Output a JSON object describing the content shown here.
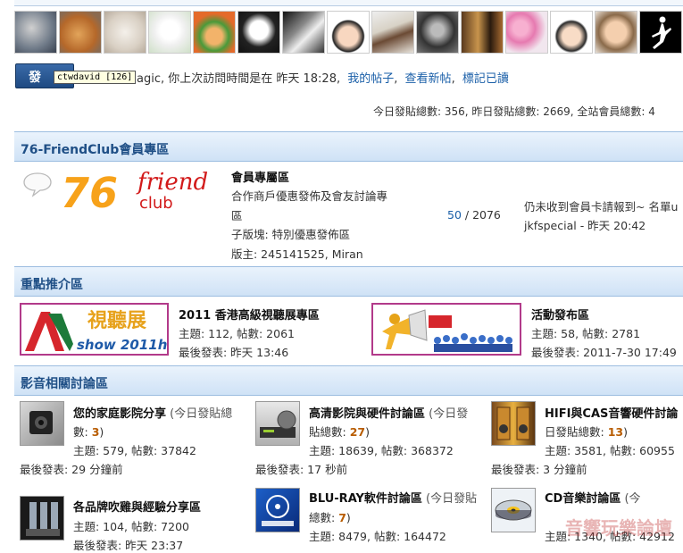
{
  "post_button": {
    "label": "發"
  },
  "tooltip": {
    "text": "ctwdavid [126]"
  },
  "welcome": {
    "text": "agic, 你上次訪問時間是在 昨天 18:28,",
    "my_posts": "我的帖子",
    "view_new": "查看新帖",
    "mark_read": "標記已讀"
  },
  "stats": {
    "text": "今日發貼總數: 356, 昨日發貼總數: 2669, 全站會員總數: 4"
  },
  "avatars": [
    "ultraman-avatar",
    "apple-avatar",
    "white-cat-avatar",
    "cartoon-head-avatar",
    "green-hair-avatar",
    "skull-avatar",
    "bw-photo-avatar",
    "cartoon-face-avatar",
    "horse-rider-avatar",
    "bw-portrait-avatar",
    "room-avatar",
    "pink-hat-girls-avatar",
    "cartoon-girl-avatar",
    "baby-avatar",
    "jumpman-avatar"
  ],
  "sections": {
    "friendclub": {
      "title": "76-FriendClub會員專區",
      "logo": {
        "num": "76",
        "word1": "friend",
        "word2": "club"
      },
      "forum": {
        "name": "會員專屬區",
        "desc1": "合作商戶優惠發佈及會友討論專",
        "desc2": "區",
        "sub": "子版塊: 特別優惠發佈區",
        "mods": "版主: 245141525, Miran",
        "counts_a": "50",
        "counts_b": " / 2076",
        "last_title": "仍未收到會員卡請報到~ 名單u",
        "last_by": "jkfspecial - 昨天 20:42"
      }
    },
    "featured": {
      "title": "重點推介區",
      "items": [
        {
          "name": "2011 香港高級視聽展專區",
          "stats": "主題: 112, 帖數: 2061",
          "last": "最後發表: 昨天 13:46",
          "banner_text": "視聽展",
          "banner_sub": "show 2011hk"
        },
        {
          "name": "活動發布區",
          "stats": "主題: 58, 帖數: 2781",
          "last": "最後發表: 2011-7-30 17:49"
        }
      ]
    },
    "av": {
      "title": "影音相關討論區",
      "forums": [
        {
          "name": "您的家庭影院分享",
          "today_a": " (今日發貼總",
          "today_b": "數: ",
          "today_num": "3",
          "today_end": ")",
          "stats": "主題: 579, 帖數: 37842",
          "last": "最後發表: 29 分鐘前"
        },
        {
          "name": "高清影院與硬件討論區",
          "today_a": " (今日發",
          "today_b": "貼總數: ",
          "today_num": "27",
          "today_end": ")",
          "stats": "主題: 18639, 帖數: 368372",
          "last": "最後發表: 17 秒前"
        },
        {
          "name": "HIFI與CAS音響硬件討論",
          "today_a": "",
          "today_b": "日發貼總數: ",
          "today_num": "13",
          "today_end": ")",
          "stats": "主題: 3581, 帖數: 60955",
          "last": "最後發表: 3 分鐘前"
        },
        {
          "name": "各品牌吹雞與經驗分享區",
          "stats": "主題: 104, 帖數: 7200",
          "last": "最後發表: 昨天 23:37"
        },
        {
          "name": "BLU-RAY軟件討論區",
          "today_a": " (今日發貼",
          "today_b": "總數: ",
          "today_num": "7",
          "today_end": ")",
          "stats": "主題: 8479, 帖數: 164472"
        },
        {
          "name": "CD音樂討論區",
          "today_a": " (今",
          "stats": "主題: 1340, 帖數: 42912"
        }
      ]
    }
  },
  "watermark": "音響玩樂論壇"
}
